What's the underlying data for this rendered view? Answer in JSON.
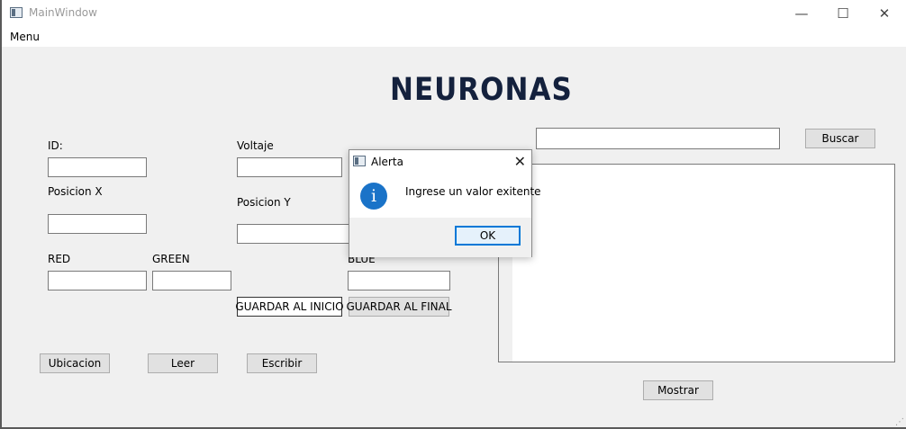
{
  "window": {
    "title": "MainWindow",
    "minimize": "—",
    "maximize": "☐",
    "close": "✕"
  },
  "menu": {
    "label": "Menu"
  },
  "heading": "NEURONAS",
  "form": {
    "id_label": "ID:",
    "voltaje_label": "Voltaje",
    "posx_label": "Posicion X",
    "posy_label": "Posicion Y",
    "red_label": "RED",
    "green_label": "GREEN",
    "blue_label": "BLUE",
    "id_value": "",
    "voltaje_value": "",
    "posx_value": "",
    "posy_value": "",
    "red_value": "",
    "green_value": "",
    "blue_value": ""
  },
  "buttons": {
    "guardar_inicio": "GUARDAR AL INICIO",
    "guardar_final": "GUARDAR AL FINAL",
    "ubicacion": "Ubicacion",
    "leer": "Leer",
    "escribir": "Escribir",
    "buscar": "Buscar",
    "mostrar": "Mostrar"
  },
  "search": {
    "value": ""
  },
  "dialog": {
    "title": "Alerta",
    "close": "✕",
    "icon": "info-icon",
    "icon_glyph": "i",
    "message": "Ingrese un valor exitente",
    "ok": "OK"
  },
  "colors": {
    "heading": "#14213d",
    "accent": "#0078d7",
    "info": "#1a73c8"
  }
}
